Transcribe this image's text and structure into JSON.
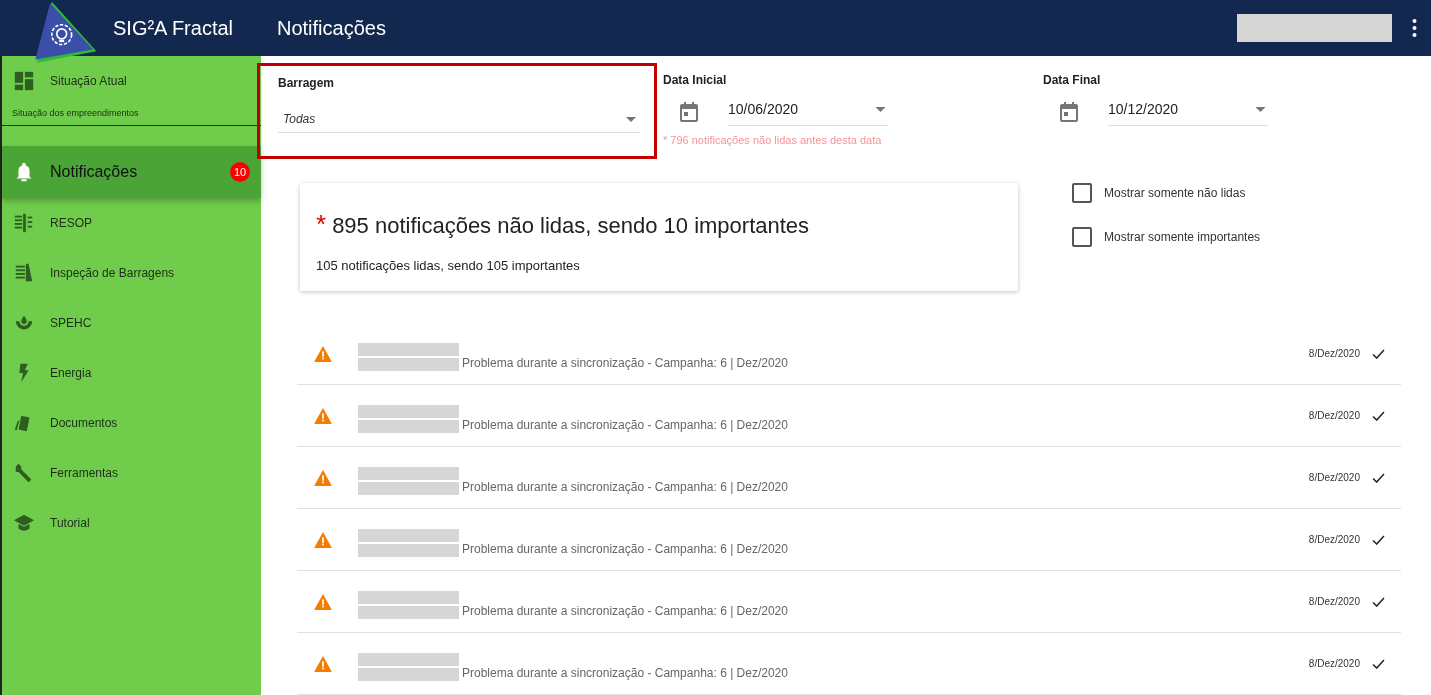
{
  "app": {
    "name": "SIG²A Fractal",
    "page_title": "Notificações"
  },
  "sidebar": {
    "items": [
      {
        "label": "Situação Atual",
        "subtitle": "Situação dos empreendimentos",
        "selected": false
      },
      {
        "label": "Notificações",
        "badge": "10",
        "selected": true
      },
      {
        "label": "RESOP",
        "selected": false
      },
      {
        "label": "Inspeção de Barragens",
        "selected": false
      },
      {
        "label": "SPEHC",
        "selected": false
      },
      {
        "label": "Energia",
        "selected": false
      },
      {
        "label": "Documentos",
        "selected": false
      },
      {
        "label": "Ferramentas",
        "selected": false
      },
      {
        "label": "Tutorial",
        "selected": false
      }
    ]
  },
  "filters": {
    "dam": {
      "label": "Barragem",
      "value": "Todas",
      "highlighted": true
    },
    "start_date": {
      "label": "Data Inicial",
      "value": "10/06/2020",
      "note": "* 796 notificações não lidas antes desta data"
    },
    "end_date": {
      "label": "Data Final",
      "value": "10/12/2020"
    }
  },
  "summary": {
    "mark": "*",
    "headline": "895 notificações não lidas, sendo 10 importantes",
    "subline": "105 notificações lidas, sendo 105 importantes"
  },
  "options": [
    {
      "label": "Mostrar somente não lidas",
      "checked": false
    },
    {
      "label": "Mostrar somente importantes",
      "checked": false
    }
  ],
  "notifications": [
    {
      "text": "Problema durante a sincronização - Campanha: 6 | Dez/2020",
      "date": "8/Dez/2020",
      "read": true
    },
    {
      "text": "Problema durante a sincronização - Campanha: 6 | Dez/2020",
      "date": "8/Dez/2020",
      "read": true
    },
    {
      "text": "Problema durante a sincronização - Campanha: 6 | Dez/2020",
      "date": "8/Dez/2020",
      "read": true
    },
    {
      "text": "Problema durante a sincronização - Campanha: 6 | Dez/2020",
      "date": "8/Dez/2020",
      "read": true
    },
    {
      "text": "Problema durante a sincronização - Campanha: 6 | Dez/2020",
      "date": "8/Dez/2020",
      "read": true
    },
    {
      "text": "Problema durante a sincronização - Campanha: 6 | Dez/2020",
      "date": "8/Dez/2020",
      "read": true
    }
  ]
}
